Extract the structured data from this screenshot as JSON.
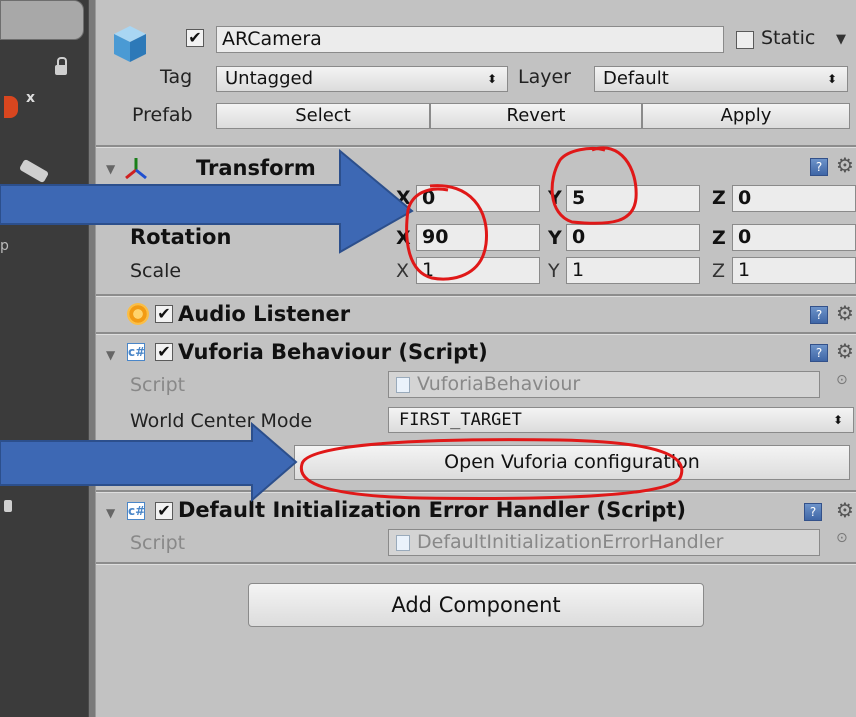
{
  "gameobject": {
    "name": "ARCamera",
    "active": true,
    "static_label": "Static",
    "static_checked": false
  },
  "tag": {
    "label": "Tag",
    "value": "Untagged"
  },
  "layer": {
    "label": "Layer",
    "value": "Default"
  },
  "prefab": {
    "label": "Prefab",
    "select": "Select",
    "revert": "Revert",
    "apply": "Apply"
  },
  "transform": {
    "title": "Transform",
    "rotation_label": "Rotation",
    "scale_label": "Scale",
    "position": {
      "x": "0",
      "y": "5",
      "z": "0"
    },
    "rotation": {
      "x": "90",
      "y": "0",
      "z": "0"
    },
    "scale": {
      "x": "1",
      "y": "1",
      "z": "1"
    },
    "axis": {
      "x": "X",
      "y": "Y",
      "z": "Z"
    }
  },
  "audio_listener": {
    "title": "Audio Listener"
  },
  "vuforia": {
    "title": "Vuforia Behaviour (Script)",
    "script_label": "Script",
    "script_value": "VuforiaBehaviour",
    "world_center_label": "World Center Mode",
    "world_center_value": "FIRST_TARGET",
    "config_button": "Open Vuforia configuration"
  },
  "default_handler": {
    "title": "Default Initialization Error Handler (Script)",
    "script_label": "Script",
    "script_value": "DefaultInitializationErrorHandler"
  },
  "add_component": "Add Component",
  "colors": {
    "arrow": "#3d68b4",
    "annotation": "#e01818",
    "panel": "#c2c2c2"
  }
}
